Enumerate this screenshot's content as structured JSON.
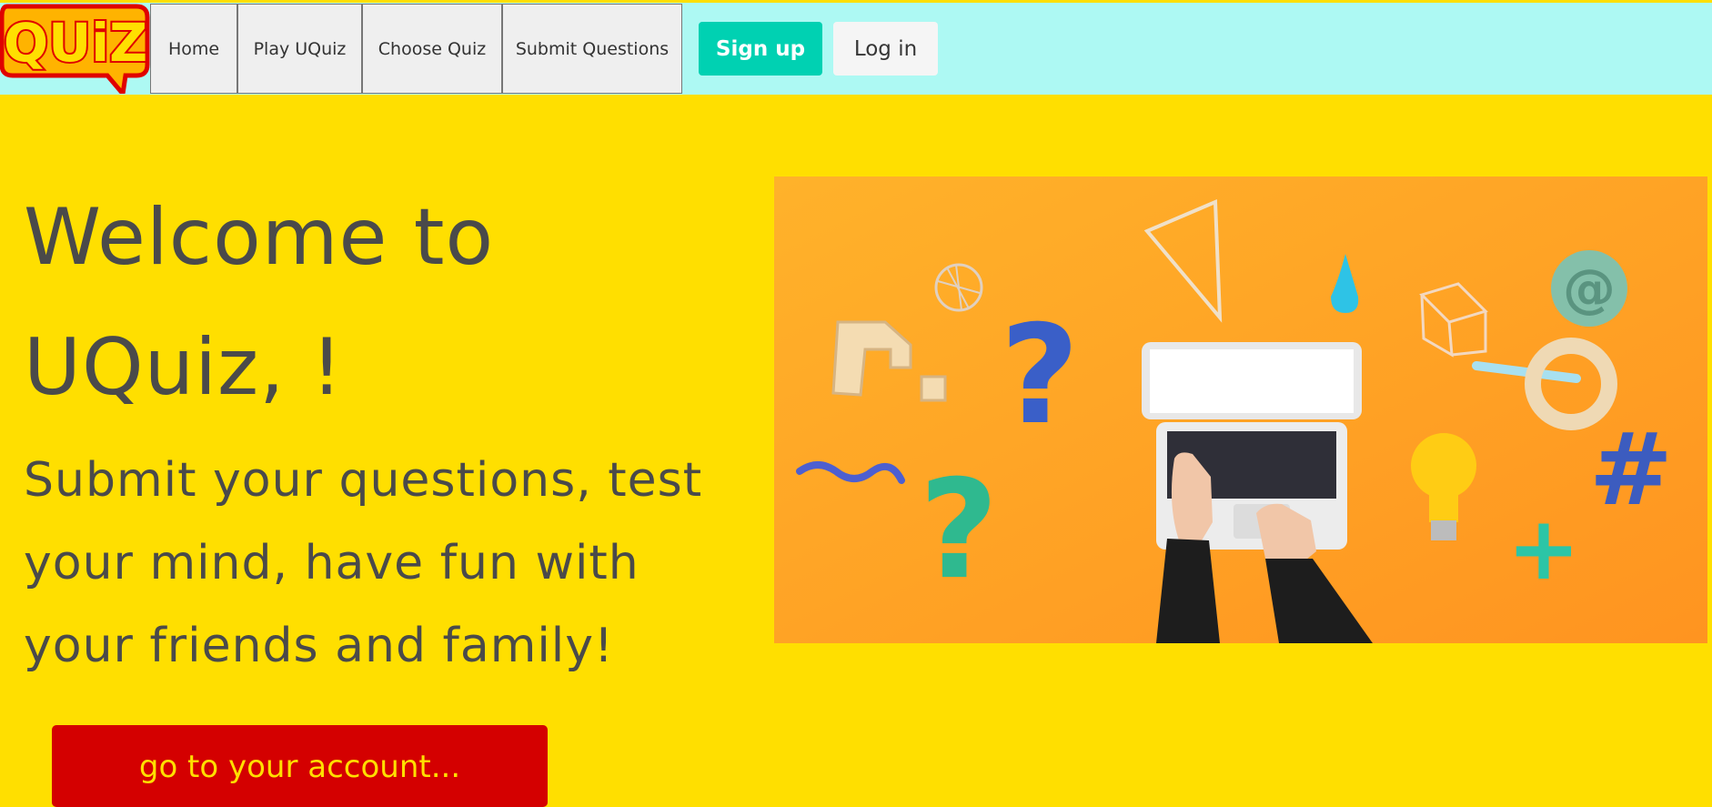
{
  "brand": {
    "logo_text": "QUiZ"
  },
  "nav": {
    "items": [
      {
        "label": "Home"
      },
      {
        "label": "Play UQuiz"
      },
      {
        "label": "Choose Quiz"
      },
      {
        "label": "Submit Questions"
      }
    ],
    "signup_label": "Sign up",
    "login_label": "Log in"
  },
  "hero": {
    "title_line1": "Welcome to",
    "title_line2": "UQuiz, !",
    "subtitle_line1": "Submit your questions, test",
    "subtitle_line2": "your mind, have fun with",
    "subtitle_line3": "your friends and family!",
    "cta_label": "go to your account..."
  },
  "colors": {
    "page_bg": "#ffdf00",
    "navbar_bg": "#adf9f3",
    "signup_bg": "#00d1b2",
    "cta_bg": "#d40000",
    "cta_text": "#ffdf00",
    "heading_text": "#4a4a4a"
  }
}
